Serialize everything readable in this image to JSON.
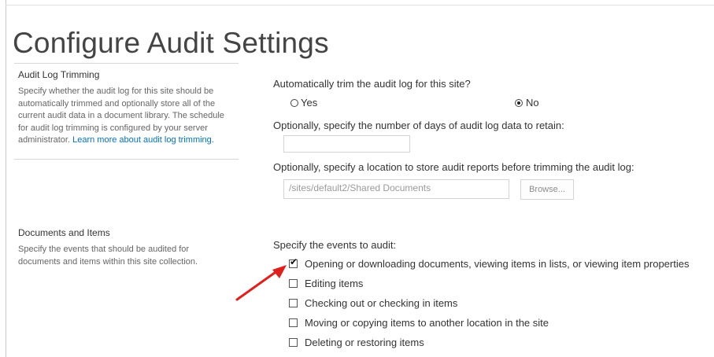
{
  "page": {
    "title": "Configure Audit Settings"
  },
  "audit_log_trimming": {
    "heading": "Audit Log Trimming",
    "description_lines": [
      "Specify whether the audit log for this site should be",
      "automatically trimmed and optionally store all of the",
      "current audit data in a document library. The schedule",
      "for audit log trimming is configured by your server",
      "administrator."
    ],
    "learn_more_link": "Learn more about audit log trimming.",
    "trim_question": "Automatically trim the audit log for this site?",
    "option_yes": "Yes",
    "option_no": "No",
    "selected_option": "No",
    "days_label": "Optionally, specify the number of days of audit log data to retain:",
    "days_value": "",
    "location_label": "Optionally, specify a location to store audit reports before trimming the audit log:",
    "location_value": "/sites/default2/Shared Documents",
    "browse_label": "Browse..."
  },
  "documents_and_items": {
    "heading": "Documents and Items",
    "description_lines": [
      "Specify the events that should be audited for",
      "documents and items within this site collection."
    ],
    "events_label": "Specify the events to audit:",
    "events": [
      {
        "label": "Opening or downloading documents, viewing items in lists, or viewing item properties",
        "checked": true
      },
      {
        "label": "Editing items",
        "checked": false
      },
      {
        "label": "Checking out or checking in items",
        "checked": false
      },
      {
        "label": "Moving or copying items to another location in the site",
        "checked": false
      },
      {
        "label": "Deleting or restoring items",
        "checked": false
      }
    ]
  },
  "colors": {
    "link": "#0072c6",
    "annotation_arrow": "#e0201b"
  },
  "icons": {
    "arrow": "red-arrow-pointer-icon",
    "check": "checkmark-icon"
  }
}
